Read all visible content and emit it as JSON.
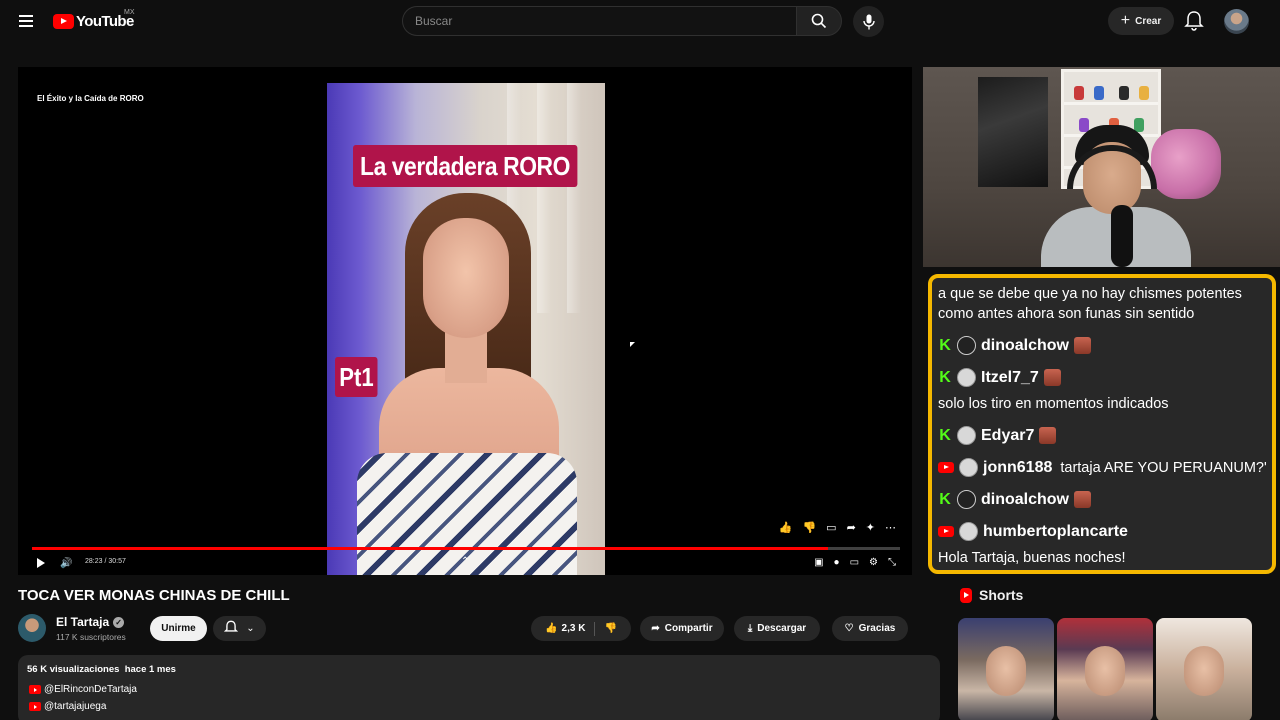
{
  "header": {
    "logo_text": "YouTube",
    "country": "MX",
    "search_placeholder": "Buscar",
    "create_label": "Crear"
  },
  "player": {
    "overlay_title": "El Éxito y la Caída de RORO",
    "video_tag": "La verdadera RORO",
    "video_part": "Pt1",
    "time": "28:23 / 30:57",
    "progress_fraction": 0.917
  },
  "chat": {
    "messages": [
      {
        "type": "text",
        "text": "a que se debe que ya no hay chismes potentes"
      },
      {
        "type": "text",
        "text": "como antes ahora son funas sin sentido"
      },
      {
        "type": "user",
        "platform": "kick",
        "user": "dinoalchow",
        "msg": "",
        "avatar": "dark"
      },
      {
        "type": "user",
        "platform": "kick",
        "user": "Itzel7_7",
        "msg": "",
        "avatar": "light"
      },
      {
        "type": "text",
        "text": "solo los tiro en momentos indicados"
      },
      {
        "type": "user",
        "platform": "kick",
        "user": "Edyar7",
        "msg": "",
        "avatar": "light"
      },
      {
        "type": "user",
        "platform": "youtube",
        "user": "jonn6188",
        "msg": "tartaja ARE YOU PERUANUM?'",
        "avatar": "light"
      },
      {
        "type": "user",
        "platform": "kick",
        "user": "dinoalchow",
        "msg": "",
        "avatar": "dark"
      },
      {
        "type": "user",
        "platform": "youtube",
        "user": "humbertoplancarte",
        "msg": "",
        "avatar": "light"
      },
      {
        "type": "text",
        "text": "Hola Tartaja, buenas noches!"
      }
    ],
    "colors": {
      "border": "#f5b800",
      "kick": "#53fc18",
      "youtube": "#ff0000"
    }
  },
  "video": {
    "title": "TOCA VER MONAS CHINAS DE CHILL",
    "channel_name": "El Tartaja",
    "subscribers": "117 K suscriptores",
    "join_label": "Unirme",
    "likes": "2,3 K",
    "share_label": "Compartir",
    "download_label": "Descargar",
    "thanks_label": "Gracias"
  },
  "description": {
    "views": "56 K visualizaciones",
    "date": "hace 1 mes",
    "links": [
      "@ElRinconDeTartaja",
      "@tartajajuega"
    ]
  },
  "shorts": {
    "heading": "Shorts"
  }
}
